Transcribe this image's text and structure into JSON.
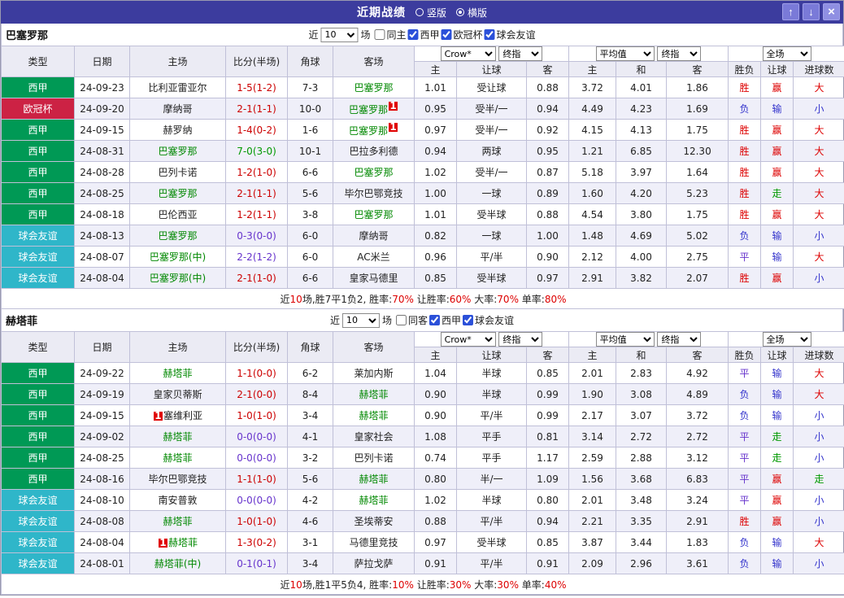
{
  "titlebar": {
    "title": "近期战绩",
    "radio_vertical": "竖版",
    "radio_horizontal": "横版",
    "selected_layout": "横版",
    "up_icon": "↑",
    "down_icon": "↓",
    "close_icon": "×"
  },
  "filters": {
    "near_label": "近",
    "count_value": "10",
    "games_label": "场"
  },
  "dropdowns": {
    "bookmaker": "Crow*",
    "stage": "终指",
    "average": "平均值",
    "scope": "全场"
  },
  "table_header": {
    "col_type": "类型",
    "col_date": "日期",
    "col_home": "主场",
    "col_score": "比分(半场)",
    "col_corner": "角球",
    "col_away": "客场",
    "sub_home": "主",
    "sub_handicap": "让球",
    "sub_away": "客",
    "sub_home2": "主",
    "sub_draw": "和",
    "sub_away2": "客",
    "col_result": "胜负",
    "col_handicap_result": "让球",
    "col_goals": "进球数"
  },
  "colors": {
    "titlebar_bg": "#3c3c9e",
    "league_liga": "#009955",
    "league_ucl": "#cc2244",
    "league_friendly": "#2fb6c9",
    "win_red": "#dd0000",
    "lose_blue": "#3333cc",
    "draw_purple": "#6633cc",
    "push_green": "#009900",
    "focus_team_green": "#008800"
  },
  "sections": [
    {
      "team": "巴塞罗那",
      "checkboxes": [
        {
          "label": "同主",
          "checked": false
        },
        {
          "label": "西甲",
          "checked": true
        },
        {
          "label": "欧冠杯",
          "checked": true
        },
        {
          "label": "球会友谊",
          "checked": true
        }
      ],
      "rows": [
        {
          "type": "西甲",
          "type_bg": "#009955",
          "date": "24-09-23",
          "home": "比利亚雷亚尔",
          "home_color": "#222222",
          "home_card": "",
          "score": "1-5(1-2)",
          "score_color": "#cc0000",
          "corner": "7-3",
          "away": "巴塞罗那",
          "away_color": "#008800",
          "away_card": "",
          "odds": [
            "1.01",
            "受让球",
            "0.88",
            "3.72",
            "4.01",
            "1.86"
          ],
          "result": "胜",
          "result_color": "#dd0000",
          "handicap_result": "赢",
          "handicap_color": "#dd0000",
          "goal_result": "大",
          "goal_color": "#dd0000"
        },
        {
          "type": "欧冠杯",
          "type_bg": "#cc2244",
          "date": "24-09-20",
          "home": "摩纳哥",
          "home_color": "#222222",
          "home_card": "",
          "score": "2-1(1-1)",
          "score_color": "#cc0000",
          "corner": "10-0",
          "away": "巴塞罗那",
          "away_color": "#008800",
          "away_card": "1",
          "odds": [
            "0.95",
            "受半/一",
            "0.94",
            "4.49",
            "4.23",
            "1.69"
          ],
          "result": "负",
          "result_color": "#3333cc",
          "handicap_result": "输",
          "handicap_color": "#3333cc",
          "goal_result": "小",
          "goal_color": "#3333cc"
        },
        {
          "type": "西甲",
          "type_bg": "#009955",
          "date": "24-09-15",
          "home": "赫罗纳",
          "home_color": "#222222",
          "home_card": "",
          "score": "1-4(0-2)",
          "score_color": "#cc0000",
          "corner": "1-6",
          "away": "巴塞罗那",
          "away_color": "#008800",
          "away_card": "1",
          "odds": [
            "0.97",
            "受半/一",
            "0.92",
            "4.15",
            "4.13",
            "1.75"
          ],
          "result": "胜",
          "result_color": "#dd0000",
          "handicap_result": "赢",
          "handicap_color": "#dd0000",
          "goal_result": "大",
          "goal_color": "#dd0000"
        },
        {
          "type": "西甲",
          "type_bg": "#009955",
          "date": "24-08-31",
          "home": "巴塞罗那",
          "home_color": "#008800",
          "home_card": "",
          "score": "7-0(3-0)",
          "score_color": "#009900",
          "corner": "10-1",
          "away": "巴拉多利德",
          "away_color": "#222222",
          "away_card": "",
          "odds": [
            "0.94",
            "两球",
            "0.95",
            "1.21",
            "6.85",
            "12.30"
          ],
          "result": "胜",
          "result_color": "#dd0000",
          "handicap_result": "赢",
          "handicap_color": "#dd0000",
          "goal_result": "大",
          "goal_color": "#dd0000"
        },
        {
          "type": "西甲",
          "type_bg": "#009955",
          "date": "24-08-28",
          "home": "巴列卡诺",
          "home_color": "#222222",
          "home_card": "",
          "score": "1-2(1-0)",
          "score_color": "#cc0000",
          "corner": "6-6",
          "away": "巴塞罗那",
          "away_color": "#008800",
          "away_card": "",
          "odds": [
            "1.02",
            "受半/一",
            "0.87",
            "5.18",
            "3.97",
            "1.64"
          ],
          "result": "胜",
          "result_color": "#dd0000",
          "handicap_result": "赢",
          "handicap_color": "#dd0000",
          "goal_result": "大",
          "goal_color": "#dd0000"
        },
        {
          "type": "西甲",
          "type_bg": "#009955",
          "date": "24-08-25",
          "home": "巴塞罗那",
          "home_color": "#008800",
          "home_card": "",
          "score": "2-1(1-1)",
          "score_color": "#cc0000",
          "corner": "5-6",
          "away": "毕尔巴鄂竞技",
          "away_color": "#222222",
          "away_card": "",
          "odds": [
            "1.00",
            "一球",
            "0.89",
            "1.60",
            "4.20",
            "5.23"
          ],
          "result": "胜",
          "result_color": "#dd0000",
          "handicap_result": "走",
          "handicap_color": "#009900",
          "goal_result": "大",
          "goal_color": "#dd0000"
        },
        {
          "type": "西甲",
          "type_bg": "#009955",
          "date": "24-08-18",
          "home": "巴伦西亚",
          "home_color": "#222222",
          "home_card": "",
          "score": "1-2(1-1)",
          "score_color": "#cc0000",
          "corner": "3-8",
          "away": "巴塞罗那",
          "away_color": "#008800",
          "away_card": "",
          "odds": [
            "1.01",
            "受半球",
            "0.88",
            "4.54",
            "3.80",
            "1.75"
          ],
          "result": "胜",
          "result_color": "#dd0000",
          "handicap_result": "赢",
          "handicap_color": "#dd0000",
          "goal_result": "大",
          "goal_color": "#dd0000"
        },
        {
          "type": "球会友谊",
          "type_bg": "#2fb6c9",
          "date": "24-08-13",
          "home": "巴塞罗那",
          "home_color": "#008800",
          "home_card": "",
          "score": "0-3(0-0)",
          "score_color": "#6633cc",
          "corner": "6-0",
          "away": "摩纳哥",
          "away_color": "#222222",
          "away_card": "",
          "odds": [
            "0.82",
            "一球",
            "1.00",
            "1.48",
            "4.69",
            "5.02"
          ],
          "result": "负",
          "result_color": "#3333cc",
          "handicap_result": "输",
          "handicap_color": "#3333cc",
          "goal_result": "小",
          "goal_color": "#3333cc"
        },
        {
          "type": "球会友谊",
          "type_bg": "#2fb6c9",
          "date": "24-08-07",
          "home": "巴塞罗那(中)",
          "home_color": "#008800",
          "home_card": "",
          "score": "2-2(1-2)",
          "score_color": "#6633cc",
          "corner": "6-0",
          "away": "AC米兰",
          "away_color": "#222222",
          "away_card": "",
          "odds": [
            "0.96",
            "平/半",
            "0.90",
            "2.12",
            "4.00",
            "2.75"
          ],
          "result": "平",
          "result_color": "#6633cc",
          "handicap_result": "输",
          "handicap_color": "#3333cc",
          "goal_result": "大",
          "goal_color": "#dd0000"
        },
        {
          "type": "球会友谊",
          "type_bg": "#2fb6c9",
          "date": "24-08-04",
          "home": "巴塞罗那(中)",
          "home_color": "#008800",
          "home_card": "",
          "score": "2-1(1-0)",
          "score_color": "#cc0000",
          "corner": "6-6",
          "away": "皇家马德里",
          "away_color": "#222222",
          "away_card": "",
          "odds": [
            "0.85",
            "受半球",
            "0.97",
            "2.91",
            "3.82",
            "2.07"
          ],
          "result": "胜",
          "result_color": "#dd0000",
          "handicap_result": "赢",
          "handicap_color": "#dd0000",
          "goal_result": "小",
          "goal_color": "#3333cc"
        }
      ],
      "summary": [
        {
          "text": "近",
          "color": "#222222"
        },
        {
          "text": "10",
          "color": "#dd0000"
        },
        {
          "text": "场,胜7平1负2, 胜率:",
          "color": "#222222"
        },
        {
          "text": "70%",
          "color": "#dd0000"
        },
        {
          "text": " 让胜率:",
          "color": "#222222"
        },
        {
          "text": "60%",
          "color": "#dd0000"
        },
        {
          "text": " 大率:",
          "color": "#222222"
        },
        {
          "text": "70%",
          "color": "#dd0000"
        },
        {
          "text": " 单率:",
          "color": "#222222"
        },
        {
          "text": "80%",
          "color": "#dd0000"
        }
      ]
    },
    {
      "team": "赫塔菲",
      "checkboxes": [
        {
          "label": "同客",
          "checked": false
        },
        {
          "label": "西甲",
          "checked": true
        },
        {
          "label": "球会友谊",
          "checked": true
        }
      ],
      "rows": [
        {
          "type": "西甲",
          "type_bg": "#009955",
          "date": "24-09-22",
          "home": "赫塔菲",
          "home_color": "#008800",
          "home_card": "",
          "score": "1-1(0-0)",
          "score_color": "#cc0000",
          "corner": "6-2",
          "away": "莱加内斯",
          "away_color": "#222222",
          "away_card": "",
          "odds": [
            "1.04",
            "半球",
            "0.85",
            "2.01",
            "2.83",
            "4.92"
          ],
          "result": "平",
          "result_color": "#6633cc",
          "handicap_result": "输",
          "handicap_color": "#3333cc",
          "goal_result": "大",
          "goal_color": "#dd0000"
        },
        {
          "type": "西甲",
          "type_bg": "#009955",
          "date": "24-09-19",
          "home": "皇家贝蒂斯",
          "home_color": "#222222",
          "home_card": "",
          "score": "2-1(0-0)",
          "score_color": "#cc0000",
          "corner": "8-4",
          "away": "赫塔菲",
          "away_color": "#008800",
          "away_card": "",
          "odds": [
            "0.90",
            "半球",
            "0.99",
            "1.90",
            "3.08",
            "4.89"
          ],
          "result": "负",
          "result_color": "#3333cc",
          "handicap_result": "输",
          "handicap_color": "#3333cc",
          "goal_result": "大",
          "goal_color": "#dd0000"
        },
        {
          "type": "西甲",
          "type_bg": "#009955",
          "date": "24-09-15",
          "home": "塞维利亚",
          "home_color": "#222222",
          "home_card": "1",
          "score": "1-0(1-0)",
          "score_color": "#cc0000",
          "corner": "3-4",
          "away": "赫塔菲",
          "away_color": "#008800",
          "away_card": "",
          "odds": [
            "0.90",
            "平/半",
            "0.99",
            "2.17",
            "3.07",
            "3.72"
          ],
          "result": "负",
          "result_color": "#3333cc",
          "handicap_result": "输",
          "handicap_color": "#3333cc",
          "goal_result": "小",
          "goal_color": "#3333cc"
        },
        {
          "type": "西甲",
          "type_bg": "#009955",
          "date": "24-09-02",
          "home": "赫塔菲",
          "home_color": "#008800",
          "home_card": "",
          "score": "0-0(0-0)",
          "score_color": "#6633cc",
          "corner": "4-1",
          "away": "皇家社会",
          "away_color": "#222222",
          "away_card": "",
          "odds": [
            "1.08",
            "平手",
            "0.81",
            "3.14",
            "2.72",
            "2.72"
          ],
          "result": "平",
          "result_color": "#6633cc",
          "handicap_result": "走",
          "handicap_color": "#009900",
          "goal_result": "小",
          "goal_color": "#3333cc"
        },
        {
          "type": "西甲",
          "type_bg": "#009955",
          "date": "24-08-25",
          "home": "赫塔菲",
          "home_color": "#008800",
          "home_card": "",
          "score": "0-0(0-0)",
          "score_color": "#6633cc",
          "corner": "3-2",
          "away": "巴列卡诺",
          "away_color": "#222222",
          "away_card": "",
          "odds": [
            "0.74",
            "平手",
            "1.17",
            "2.59",
            "2.88",
            "3.12"
          ],
          "result": "平",
          "result_color": "#6633cc",
          "handicap_result": "走",
          "handicap_color": "#009900",
          "goal_result": "小",
          "goal_color": "#3333cc"
        },
        {
          "type": "西甲",
          "type_bg": "#009955",
          "date": "24-08-16",
          "home": "毕尔巴鄂竞技",
          "home_color": "#222222",
          "home_card": "",
          "score": "1-1(1-0)",
          "score_color": "#cc0000",
          "corner": "5-6",
          "away": "赫塔菲",
          "away_color": "#008800",
          "away_card": "",
          "odds": [
            "0.80",
            "半/一",
            "1.09",
            "1.56",
            "3.68",
            "6.83"
          ],
          "result": "平",
          "result_color": "#6633cc",
          "handicap_result": "赢",
          "handicap_color": "#dd0000",
          "goal_result": "走",
          "goal_color": "#009900"
        },
        {
          "type": "球会友谊",
          "type_bg": "#2fb6c9",
          "date": "24-08-10",
          "home": "南安普敦",
          "home_color": "#222222",
          "home_card": "",
          "score": "0-0(0-0)",
          "score_color": "#6633cc",
          "corner": "4-2",
          "away": "赫塔菲",
          "away_color": "#008800",
          "away_card": "",
          "odds": [
            "1.02",
            "半球",
            "0.80",
            "2.01",
            "3.48",
            "3.24"
          ],
          "result": "平",
          "result_color": "#6633cc",
          "handicap_result": "赢",
          "handicap_color": "#dd0000",
          "goal_result": "小",
          "goal_color": "#3333cc"
        },
        {
          "type": "球会友谊",
          "type_bg": "#2fb6c9",
          "date": "24-08-08",
          "home": "赫塔菲",
          "home_color": "#008800",
          "home_card": "",
          "score": "1-0(1-0)",
          "score_color": "#cc0000",
          "corner": "4-6",
          "away": "圣埃蒂安",
          "away_color": "#222222",
          "away_card": "",
          "odds": [
            "0.88",
            "平/半",
            "0.94",
            "2.21",
            "3.35",
            "2.91"
          ],
          "result": "胜",
          "result_color": "#dd0000",
          "handicap_result": "赢",
          "handicap_color": "#dd0000",
          "goal_result": "小",
          "goal_color": "#3333cc"
        },
        {
          "type": "球会友谊",
          "type_bg": "#2fb6c9",
          "date": "24-08-04",
          "home": "赫塔菲",
          "home_color": "#008800",
          "home_card": "1",
          "score": "1-3(0-2)",
          "score_color": "#cc0000",
          "corner": "3-1",
          "away": "马德里竞技",
          "away_color": "#222222",
          "away_card": "",
          "odds": [
            "0.97",
            "受半球",
            "0.85",
            "3.87",
            "3.44",
            "1.83"
          ],
          "result": "负",
          "result_color": "#3333cc",
          "handicap_result": "输",
          "handicap_color": "#3333cc",
          "goal_result": "大",
          "goal_color": "#dd0000"
        },
        {
          "type": "球会友谊",
          "type_bg": "#2fb6c9",
          "date": "24-08-01",
          "home": "赫塔菲(中)",
          "home_color": "#008800",
          "home_card": "",
          "score": "0-1(0-1)",
          "score_color": "#6633cc",
          "corner": "3-4",
          "away": "萨拉戈萨",
          "away_color": "#222222",
          "away_card": "",
          "odds": [
            "0.91",
            "平/半",
            "0.91",
            "2.09",
            "2.96",
            "3.61"
          ],
          "result": "负",
          "result_color": "#3333cc",
          "handicap_result": "输",
          "handicap_color": "#3333cc",
          "goal_result": "小",
          "goal_color": "#3333cc"
        }
      ],
      "summary": [
        {
          "text": "近",
          "color": "#222222"
        },
        {
          "text": "10",
          "color": "#dd0000"
        },
        {
          "text": "场,胜1平5负4, 胜率:",
          "color": "#222222"
        },
        {
          "text": "10%",
          "color": "#dd0000"
        },
        {
          "text": " 让胜率:",
          "color": "#222222"
        },
        {
          "text": "30%",
          "color": "#dd0000"
        },
        {
          "text": " 大率:",
          "color": "#222222"
        },
        {
          "text": "30%",
          "color": "#dd0000"
        },
        {
          "text": " 单率:",
          "color": "#222222"
        },
        {
          "text": "40%",
          "color": "#dd0000"
        }
      ]
    }
  ]
}
